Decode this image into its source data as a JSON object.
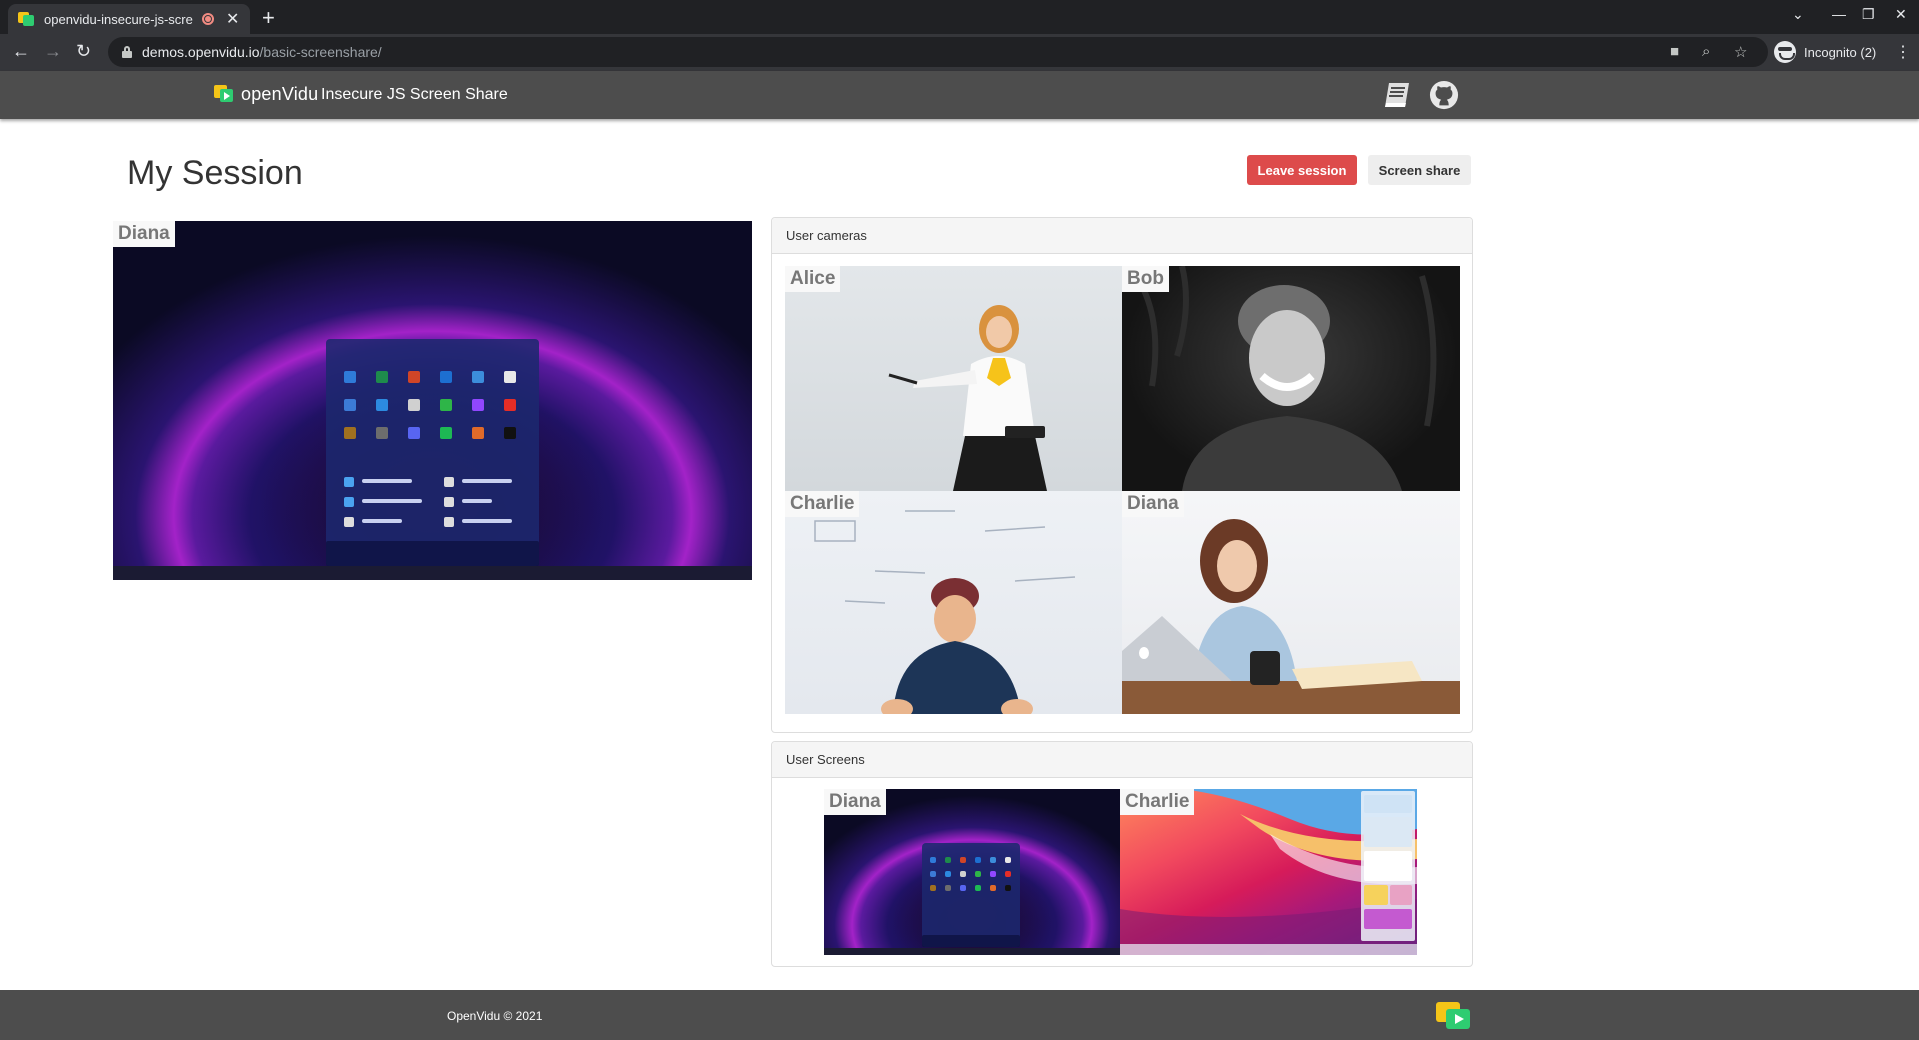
{
  "browser": {
    "tab_title": "openvidu-insecure-js-scre",
    "url_domain": "demos.openvidu.io",
    "url_path": "/basic-screenshare/",
    "profile_label": "Incognito (2)"
  },
  "header": {
    "brand": "openVidu",
    "title": "Insecure JS Screen Share",
    "icons": [
      "docs-book-icon",
      "github-icon"
    ]
  },
  "session": {
    "title": "My Session",
    "leave_label": "Leave session",
    "screen_share_label": "Screen share"
  },
  "main_video": {
    "name": "Diana"
  },
  "cameras": {
    "heading": "User cameras",
    "users": [
      {
        "name": "Alice"
      },
      {
        "name": "Bob"
      },
      {
        "name": "Charlie"
      },
      {
        "name": "Diana"
      }
    ]
  },
  "screens": {
    "heading": "User Screens",
    "users": [
      {
        "name": "Diana"
      },
      {
        "name": "Charlie"
      }
    ]
  },
  "footer": {
    "text": "OpenVidu © 2021"
  },
  "colors": {
    "leave_button": "#dd4b4b",
    "navbar": "#4d4d4d",
    "brand_yellow": "#f5c518",
    "brand_green": "#2ecc71"
  }
}
